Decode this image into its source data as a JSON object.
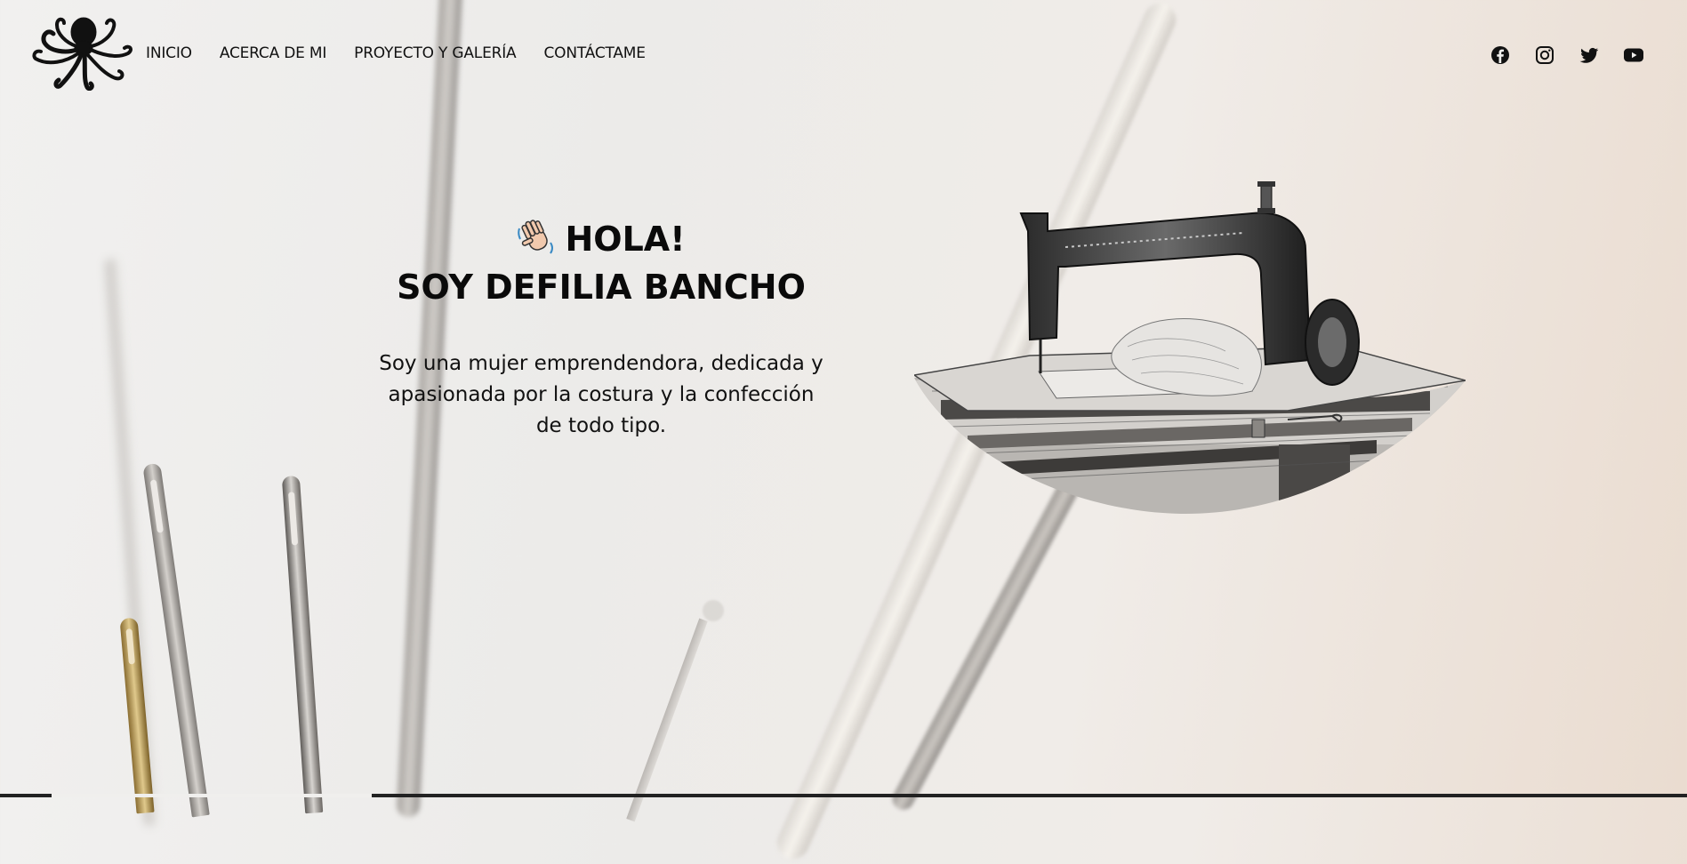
{
  "nav": {
    "items": [
      {
        "label": "INICIO"
      },
      {
        "label": "ACERCA DE MI"
      },
      {
        "label": "PROYECTO Y GALERÍA"
      },
      {
        "label": "CONTÁCTAME"
      }
    ]
  },
  "social": {
    "icons": [
      "facebook-icon",
      "instagram-icon",
      "twitter-icon",
      "youtube-icon"
    ]
  },
  "hero": {
    "greeting": "HOLA!",
    "name_line": "SOY DEFILIA BANCHO",
    "description": "Soy una mujer emprendendora, dedicada y apasionada por la costura y la confección de todo tipo."
  },
  "colors": {
    "text": "#111111",
    "background": "#efeeec"
  }
}
